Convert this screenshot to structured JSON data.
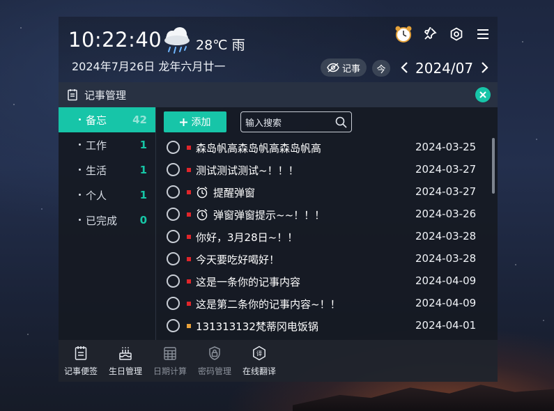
{
  "header": {
    "time": "10:22:40",
    "weather_icon": "cloud-rain-icon",
    "temperature": "28℃",
    "condition": "雨",
    "date": "2024年7月26日  龙年六月廿一",
    "note_toggle_label": "记事",
    "today_label": "今",
    "month": "2024/07"
  },
  "panel": {
    "title": "记事管理"
  },
  "sidebar": {
    "items": [
      {
        "label": "备忘",
        "count": "42",
        "active": true
      },
      {
        "label": "工作",
        "count": "1"
      },
      {
        "label": "生活",
        "count": "1"
      },
      {
        "label": "个人",
        "count": "1"
      },
      {
        "label": "已完成",
        "count": "0"
      }
    ]
  },
  "toolbar": {
    "add_label": "添加",
    "search_placeholder": "输入搜索"
  },
  "notes": [
    {
      "text": "森岛帆高森岛帆高森岛帆高",
      "date": "2024-03-25",
      "color": "#e0262b",
      "alarm": false
    },
    {
      "text": "测试测试测试~！！！",
      "date": "2024-03-27",
      "color": "#e0262b",
      "alarm": false
    },
    {
      "text": "提醒弹窗",
      "date": "2024-03-27",
      "color": "#e0262b",
      "alarm": true
    },
    {
      "text": "弹窗弹窗提示~~！！！",
      "date": "2024-03-26",
      "color": "#e0262b",
      "alarm": true
    },
    {
      "text": "你好，3月28日~！！",
      "date": "2024-03-28",
      "color": "#e0262b",
      "alarm": false
    },
    {
      "text": "今天要吃好喝好！",
      "date": "2024-03-28",
      "color": "#e0262b",
      "alarm": false
    },
    {
      "text": "这是一条你的记事内容",
      "date": "2024-04-09",
      "color": "#e0262b",
      "alarm": false
    },
    {
      "text": "这是第二条你的记事内容~！！",
      "date": "2024-04-09",
      "color": "#e0262b",
      "alarm": false
    },
    {
      "text": "131313132梵蒂冈电饭锅",
      "date": "2024-04-01",
      "color": "#e9a23b",
      "alarm": false
    }
  ],
  "footer": {
    "tools": [
      {
        "label": "记事便签",
        "icon": "notepad-icon",
        "active": true
      },
      {
        "label": "生日管理",
        "icon": "cake-icon",
        "active": true
      },
      {
        "label": "日期计算",
        "icon": "calendar-grid-icon",
        "active": false
      },
      {
        "label": "密码管理",
        "icon": "lock-icon",
        "active": false
      },
      {
        "label": "在线翻译",
        "icon": "translate-icon",
        "active": true
      }
    ]
  },
  "colors": {
    "accent": "#17c5a8",
    "priority_high": "#e0262b",
    "priority_medium": "#e9a23b"
  }
}
